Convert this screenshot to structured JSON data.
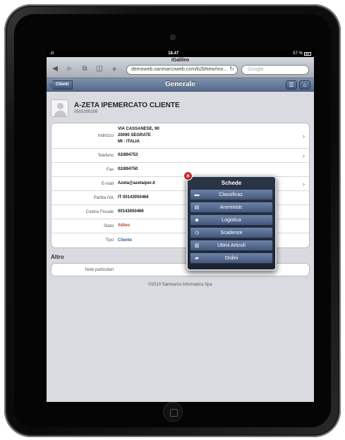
{
  "status_bar": {
    "carrier": ".ıll",
    "time": "18.47",
    "battery": "57 %"
  },
  "safari": {
    "page_title": "iGalileo",
    "url": "demoweb.sanmarcoweb.com/b2bNew/mo...",
    "search_placeholder": "Google"
  },
  "app_bar": {
    "back_label": "Clienti",
    "title": "Generale"
  },
  "client": {
    "name": "A-ZETA IPEMERCATO CLIENTE",
    "code": "0501000109"
  },
  "details": [
    {
      "label": "Indirizzo",
      "lines": [
        "VIA CASSANESE, 90",
        "20090 SEGRATE",
        "MI - ITALIA"
      ],
      "chevron": true
    },
    {
      "label": "Telefono",
      "value": "02/894753",
      "chevron": true
    },
    {
      "label": "Fax",
      "value": "02/894750",
      "chevron": false
    },
    {
      "label": "E-mail",
      "value": "Azeta@azetaiper.it",
      "chevron": true
    },
    {
      "label": "Partita IVA",
      "value": "IT 00143050466",
      "chevron": false
    },
    {
      "label": "Codice Fiscale",
      "value": "00143050466",
      "chevron": false
    },
    {
      "label": "Stato",
      "value": "Attivo",
      "chevron": false,
      "color": "red"
    },
    {
      "label": "Tipo",
      "value": "Cliente",
      "chevron": false,
      "color": "blue"
    }
  ],
  "altro": {
    "title": "Altro",
    "note_label": "Note particolari"
  },
  "footer": "©2010 Sanmarco Informatica Spa",
  "popup": {
    "title": "Schede",
    "items": [
      {
        "label": "Classificaz.",
        "icon": "list-icon"
      },
      {
        "label": "Amministr.",
        "icon": "card-icon"
      },
      {
        "label": "Logistica",
        "icon": "tag-icon"
      },
      {
        "label": "Scadenze",
        "icon": "clock-icon"
      },
      {
        "label": "Ultimi Articoli",
        "icon": "bar-chart-icon"
      },
      {
        "label": "Ordini",
        "icon": "briefcase-icon"
      }
    ]
  }
}
